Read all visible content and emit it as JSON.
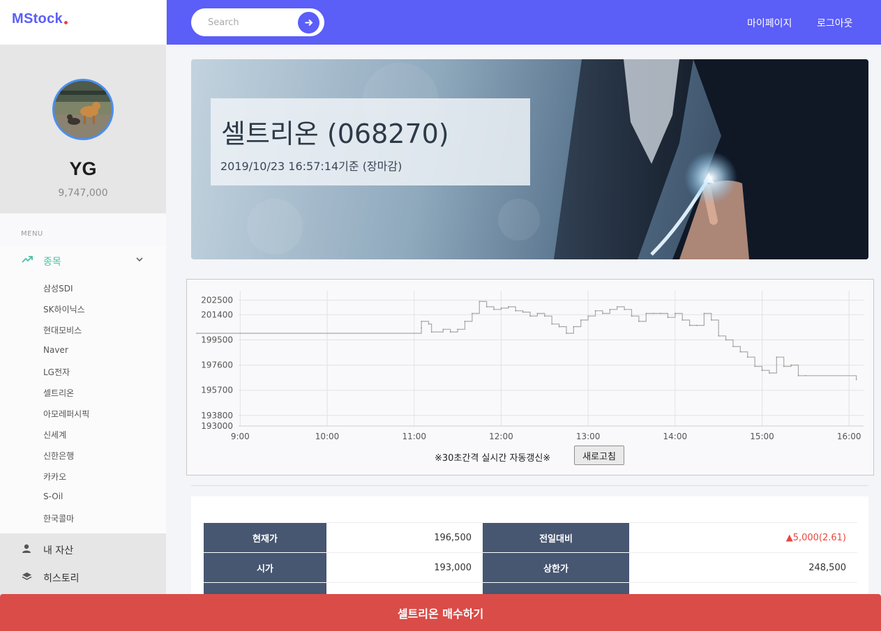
{
  "brand": {
    "name": "MStock"
  },
  "profile": {
    "name": "YG",
    "balance": "9,747,000"
  },
  "menu": {
    "heading": "MENU",
    "stocks_label": "종목",
    "stocks": [
      "삼성SDI",
      "SK하이닉스",
      "현대모비스",
      "Naver",
      "LG전자",
      "셀트리온",
      "아모레퍼시픽",
      "신세계",
      "신한은행",
      "카카오",
      "S-Oil",
      "한국콜마"
    ],
    "assets_label": "내 자산",
    "history_label": "히스토리"
  },
  "search": {
    "placeholder": "Search"
  },
  "top_links": {
    "mypage": "마이페이지",
    "logout": "로그아웃"
  },
  "stock": {
    "title": "셀트리온 (068270)",
    "timestamp": "2019/10/23  16:57:14기준 (장마감)"
  },
  "chart_data": {
    "type": "line",
    "title": "",
    "xlabel": "",
    "ylabel": "",
    "x_ticks": [
      "9:00",
      "10:00",
      "11:00",
      "12:00",
      "13:00",
      "14:00",
      "15:00",
      "16:00"
    ],
    "y_ticks": [
      202500,
      201400,
      199500,
      197600,
      195700,
      193800,
      193000
    ],
    "xlim": [
      "8:30",
      "16:10"
    ],
    "ylim": [
      193000,
      203000
    ],
    "grid": true,
    "line_color": "#a8a8a8",
    "series": [
      {
        "x": [
          "8:30",
          "11:05",
          "11:05",
          "11:10",
          "11:12",
          "11:20",
          "11:25",
          "11:30",
          "11:35",
          "11:40",
          "11:45",
          "11:50",
          "11:55",
          "12:00",
          "12:05",
          "12:10",
          "12:15",
          "12:20",
          "12:25",
          "12:30",
          "12:35",
          "12:40",
          "12:45",
          "12:50",
          "12:55",
          "13:00",
          "13:05",
          "13:10",
          "13:15",
          "13:20",
          "13:25",
          "13:30",
          "13:35",
          "13:40",
          "13:45",
          "13:50",
          "13:55",
          "14:00",
          "14:05",
          "14:10",
          "14:15",
          "14:20",
          "14:25",
          "14:30",
          "14:35",
          "14:40",
          "14:45",
          "14:50",
          "14:55",
          "15:00",
          "15:05",
          "15:10",
          "15:15",
          "15:20",
          "15:25",
          "15:30",
          "16:05"
        ],
        "y": [
          200000,
          200400,
          200900,
          200700,
          200100,
          200300,
          200100,
          200300,
          200900,
          201500,
          202400,
          202000,
          201800,
          201900,
          202000,
          201700,
          201600,
          201300,
          201500,
          201300,
          200700,
          200500,
          200000,
          200500,
          201000,
          201300,
          201700,
          201500,
          201800,
          202000,
          201800,
          201300,
          200900,
          201500,
          201500,
          201500,
          201200,
          201500,
          201000,
          200600,
          200600,
          201500,
          201000,
          199800,
          199500,
          199000,
          198600,
          198200,
          197500,
          197200,
          197000,
          198200,
          197500,
          197600,
          196800,
          196800,
          196500
        ]
      }
    ]
  },
  "refresh": {
    "note": "※30초간격 실시간 자동갱신※",
    "button_label": "새로고침"
  },
  "quote": {
    "rows": [
      [
        {
          "label": "현재가",
          "value": "196,500"
        },
        {
          "label": "전일대비",
          "value": "▲5,000(2.61)",
          "color": "#e8473f"
        }
      ],
      [
        {
          "label": "시가",
          "value": "193,000"
        },
        {
          "label": "상한가",
          "value": "248,500"
        }
      ],
      [
        {
          "label": "",
          "value": ""
        },
        {
          "label": "",
          "value": ""
        }
      ]
    ]
  },
  "buy_button": {
    "label": "셀트리온 매수하기"
  },
  "colors": {
    "brand": "#5b5ef7",
    "accent_red": "#e8473f",
    "active_menu": "#43c3a0",
    "table_header": "#475671",
    "buy_button": "#da4c48"
  }
}
